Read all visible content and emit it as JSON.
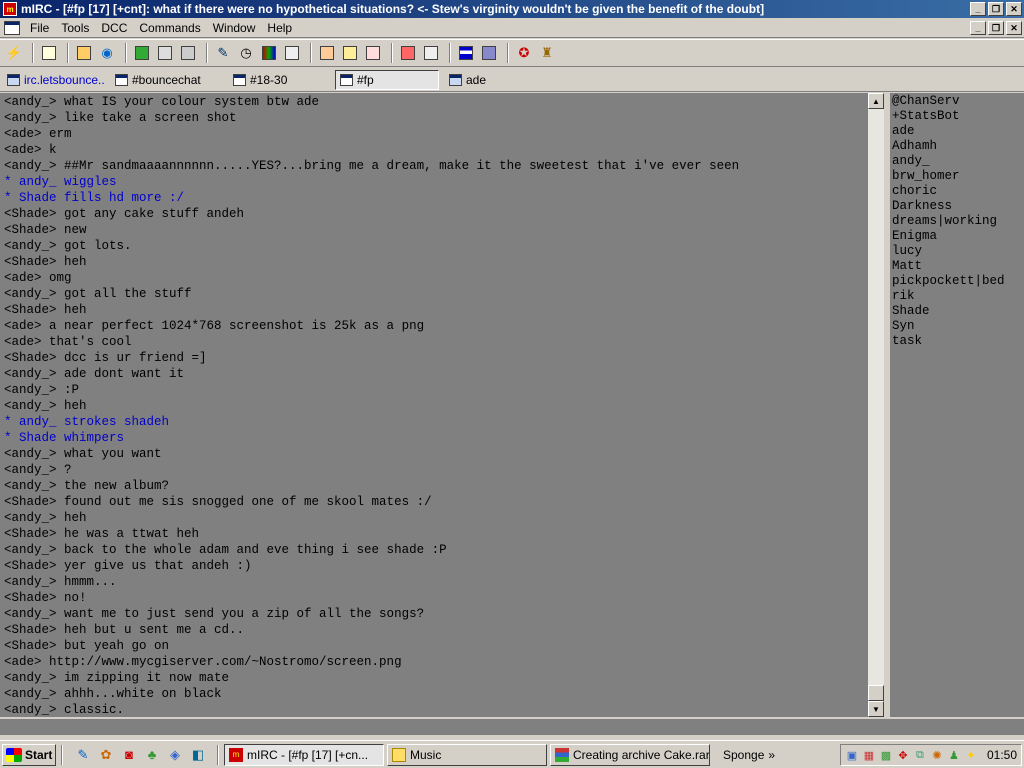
{
  "window": {
    "app_icon": "mirc-icon",
    "title": "mIRC - [#fp [17] [+cnt]: what if there were no hypothetical situations? <- Stew's virginity wouldn't be given the benefit of the doubt]",
    "minimize": "_",
    "restore": "❐",
    "close": "✕"
  },
  "menu": {
    "items": [
      "File",
      "Tools",
      "DCC",
      "Commands",
      "Window",
      "Help"
    ]
  },
  "toolbar": {
    "buttons": [
      "connect-icon",
      "options-icon",
      "address-book-icon",
      "channel-list-icon",
      "notify-icon",
      "dcc-send-icon",
      "dcc-chat-icon",
      "url-list-icon",
      "timer-icon",
      "colors-icon",
      "scripts-icon",
      "channel-folder-icon",
      "log-icon",
      "notify-list-icon",
      "dcc-options-icon",
      "received-files-icon",
      "tile-horizontal-icon",
      "cascade-icon",
      "help-icon",
      "about-icon"
    ]
  },
  "switchbar": {
    "tabs": [
      {
        "label": "irc.letsbounce....",
        "type": "status"
      },
      {
        "label": "#bouncechat",
        "type": "channel"
      },
      {
        "label": "#18-30",
        "type": "channel"
      },
      {
        "label": "#fp",
        "type": "channel",
        "active": true
      },
      {
        "label": "ade",
        "type": "query"
      }
    ]
  },
  "chat": {
    "lines": [
      {
        "text": "<andy_> what IS your colour system btw ade"
      },
      {
        "text": "<andy_> like take a screen shot"
      },
      {
        "text": "<ade> erm"
      },
      {
        "text": "<ade> k"
      },
      {
        "text": "<andy_> ##Mr sandmaaaannnnnn.....YES?...bring me a dream, make it the sweetest that i've ever seen"
      },
      {
        "text": "* andy_ wiggles",
        "action": true
      },
      {
        "text": "* Shade fills hd more :/",
        "action": true
      },
      {
        "text": "<Shade> got any cake stuff andeh"
      },
      {
        "text": "<Shade> new"
      },
      {
        "text": "<andy_> got lots."
      },
      {
        "text": "<Shade> heh"
      },
      {
        "text": "<ade> omg"
      },
      {
        "text": "<andy_> got all the stuff"
      },
      {
        "text": "<Shade> heh"
      },
      {
        "text": "<ade> a near perfect 1024*768 screenshot is 25k as a png"
      },
      {
        "text": "<ade> that's cool"
      },
      {
        "text": "<Shade> dcc is ur friend =]"
      },
      {
        "text": "<andy_> ade dont want it"
      },
      {
        "text": "<andy_> :P"
      },
      {
        "text": "<andy_> heh"
      },
      {
        "text": "* andy_ strokes shadeh",
        "action": true
      },
      {
        "text": "* Shade whimpers",
        "action": true
      },
      {
        "text": "<andy_> what you want"
      },
      {
        "text": "<andy_> ?"
      },
      {
        "text": "<andy_> the new album?"
      },
      {
        "text": "<Shade> found out me sis snogged one of me skool mates :/"
      },
      {
        "text": "<andy_> heh"
      },
      {
        "text": "<Shade> he was a ttwat heh"
      },
      {
        "text": "<andy_> back to the whole adam and eve thing i see shade :P"
      },
      {
        "text": "<Shade> yer give us that andeh :)"
      },
      {
        "text": "<andy_> hmmm..."
      },
      {
        "text": "<Shade> no!"
      },
      {
        "text": "<andy_> want me to just send you a zip of all the songs?"
      },
      {
        "text": "<Shade> heh but u sent me a cd.."
      },
      {
        "text": "<Shade> but yeah go on"
      },
      {
        "text": "<ade> http://www.mycgiserver.com/~Nostromo/screen.png"
      },
      {
        "text": "<andy_> im zipping it now mate"
      },
      {
        "text": "<andy_> ahhh...white on black"
      },
      {
        "text": "<andy_> classic."
      }
    ]
  },
  "nicklist": {
    "nicks": [
      "@ChanServ",
      "+StatsBot",
      "ade",
      "Adhamh",
      "andy_",
      "brw_homer",
      "choric",
      "Darkness",
      "dreams|working",
      "Enigma",
      "lucy",
      "Matt",
      "pickpockett|bed",
      "rik",
      "Shade",
      "Syn",
      "task"
    ]
  },
  "scrollbar": {
    "up": "▲",
    "down": "▼"
  },
  "taskbar": {
    "start": "Start",
    "quicklaunch": [
      "show-desktop-icon",
      "paint-icon",
      "mirc-icon",
      "winamp-icon",
      "media-player-icon",
      "outlook-icon"
    ],
    "tasks": [
      {
        "label": "mIRC - [#fp [17] [+cn...",
        "icon": "mirc-icon",
        "active": true
      },
      {
        "label": "Music",
        "icon": "folder-icon",
        "active": false
      },
      {
        "label": "Creating archive Cake.rar",
        "icon": "winrar-icon",
        "active": false
      }
    ],
    "toolbar_label": "Sponge",
    "toolbar_chevron": "»",
    "tray_icons": [
      "network-icon",
      "volume-icon",
      "av-icon",
      "messenger-icon",
      "network2-icon",
      "antivirus-icon",
      "msn-icon",
      "update-icon"
    ],
    "clock": "01:50"
  },
  "colors": {
    "chat_background": "#808080",
    "action_text": "#0000c8",
    "titlebar": "#0a246a"
  }
}
